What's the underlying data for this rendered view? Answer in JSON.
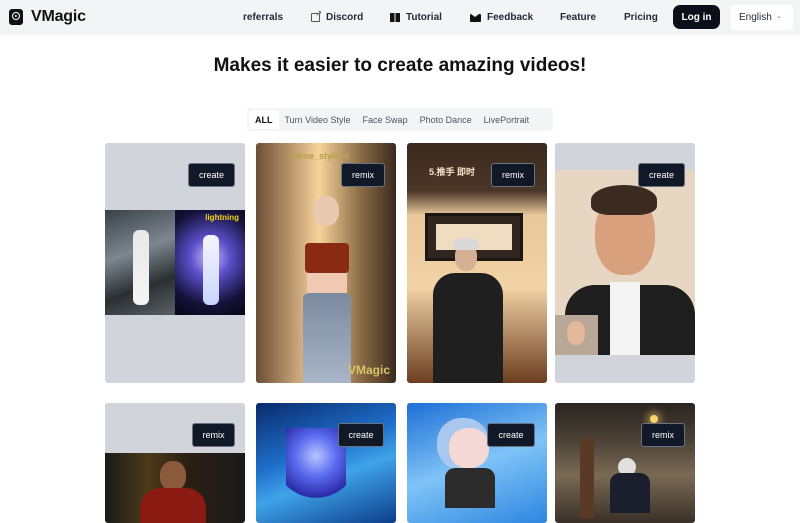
{
  "header": {
    "brand": "VMagic",
    "nav": [
      {
        "label": "referrals",
        "icon": null
      },
      {
        "label": "Discord",
        "icon": "external-link-icon"
      },
      {
        "label": "Tutorial",
        "icon": "book-icon"
      },
      {
        "label": "Feedback",
        "icon": "mail-icon"
      },
      {
        "label": "Feature",
        "icon": null
      },
      {
        "label": "Pricing",
        "icon": null
      }
    ],
    "login_label": "Log in",
    "language": "English"
  },
  "hero": {
    "title": "Makes it easier to create amazing videos!"
  },
  "tabs": [
    {
      "label": "ALL",
      "active": true
    },
    {
      "label": "Turn Video Style",
      "active": false
    },
    {
      "label": "Face Swap",
      "active": false
    },
    {
      "label": "Photo Dance",
      "active": false
    },
    {
      "label": "LivePortrait",
      "active": false
    }
  ],
  "cards": [
    {
      "action": "create",
      "subject": "dance video lightning style",
      "overlay": "lightning"
    },
    {
      "action": "remix",
      "subject": "anime style woman",
      "overlay": "anime_style_4",
      "watermark": "VMagic"
    },
    {
      "action": "remix",
      "subject": "martial arts anime man",
      "overlay": "5.推手 即时"
    },
    {
      "action": "create",
      "subject": "live portrait man face",
      "overlay": ""
    },
    {
      "action": "remix",
      "subject": "iron suit man",
      "overlay": ""
    },
    {
      "action": "create",
      "subject": "blue flower underwater",
      "overlay": ""
    },
    {
      "action": "create",
      "subject": "anime girl blue hair",
      "overlay": ""
    },
    {
      "action": "remix",
      "subject": "man in dojo",
      "overlay": ""
    }
  ],
  "colors": {
    "header_bg": "#f3f4f6",
    "primary_dark": "#0b0f1a",
    "card_placeholder": "#d1d5db"
  }
}
